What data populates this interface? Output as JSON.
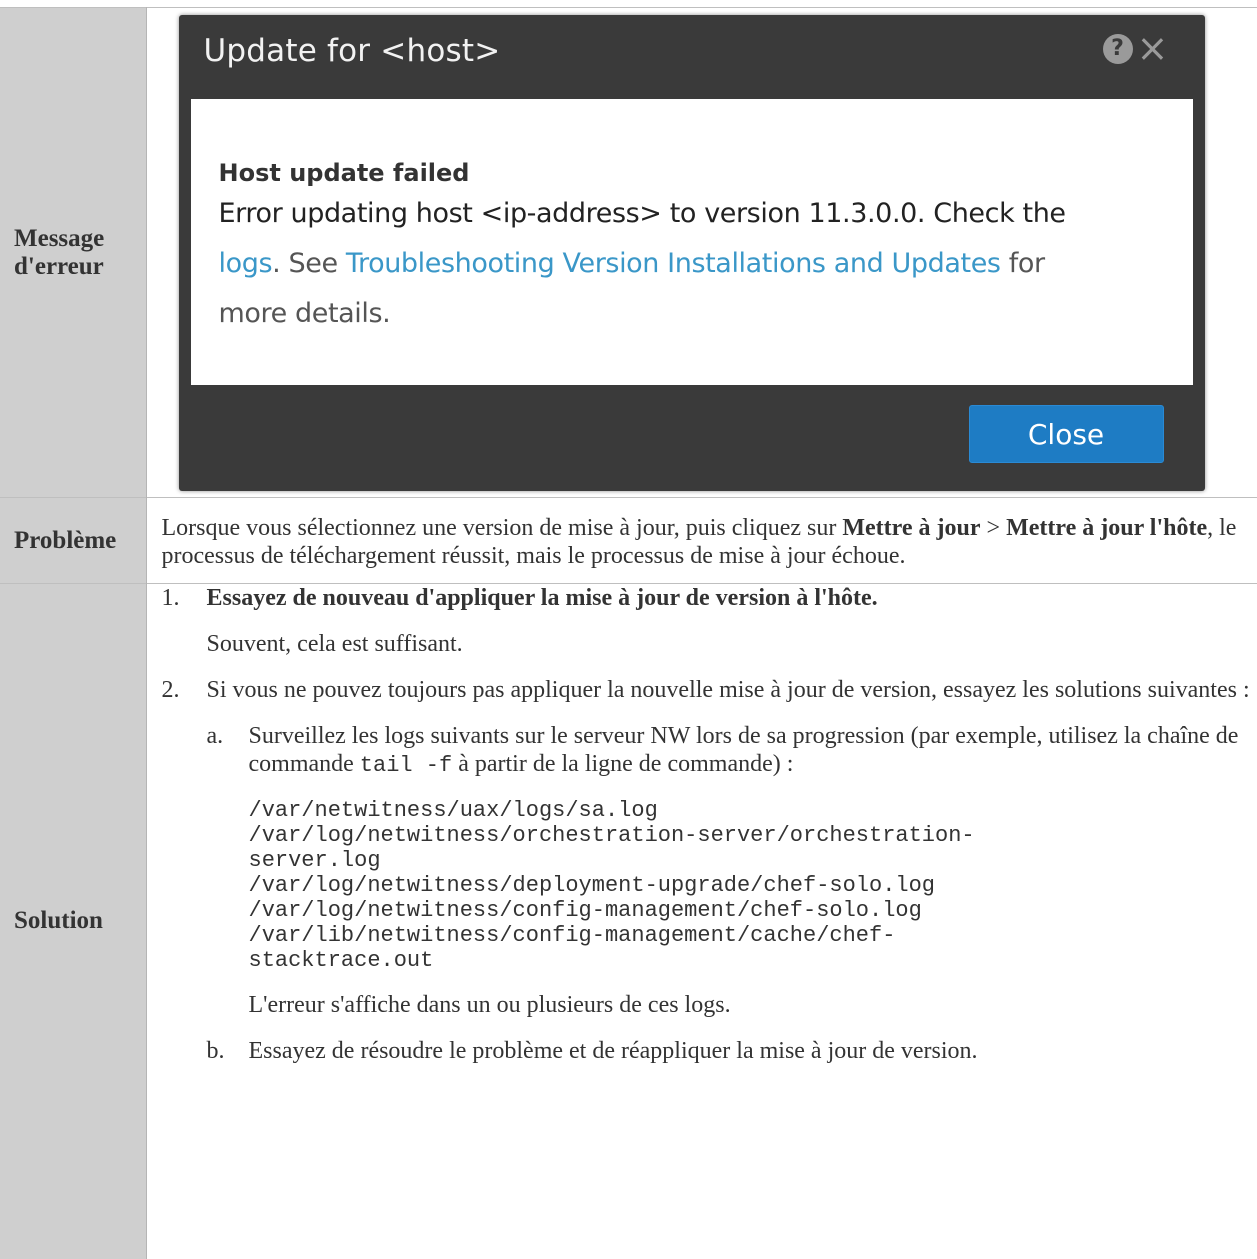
{
  "rows": {
    "message_label": "Message d'erreur",
    "problem_label": "Problème",
    "solution_label": "Solution"
  },
  "dialog": {
    "title": "Update for <host>",
    "help_icon": "?",
    "close_icon": "×",
    "heading": "Host update failed",
    "line1": "Error updating host <ip-address> to version 11.3.0.0. Check the",
    "link_logs": "logs",
    "after_logs": ". See ",
    "link_troubleshooting": "Troubleshooting Version Installations and Updates",
    "after_link": " for",
    "line3": "more details.",
    "close_button": "Close"
  },
  "problem": {
    "text1": "Lorsque vous sélectionnez une version de mise à jour, puis cliquez sur ",
    "bold1": "Mettre à jour",
    "text2": " > ",
    "bold2": "Mettre à jour l'hôte",
    "text3": ", le processus de téléchargement réussit, mais le processus de mise à jour échoue."
  },
  "solution": {
    "step1_num": "1.",
    "step1_bold": "Essayez de nouveau d'appliquer la mise à jour de version à l'hôte.",
    "step1_para": "Souvent, cela est suffisant.",
    "step2_num": "2.",
    "step2_text": "Si vous ne pouvez toujours pas appliquer la nouvelle mise à jour de version, essayez les solutions suivantes :",
    "sub_a_letter": "a.",
    "sub_a_text1": "Surveillez les logs suivants sur le serveur NW lors de sa progression (par exemple, utilisez la chaîne de commande ",
    "sub_a_code": "tail -f",
    "sub_a_text2": " à partir de la ligne de commande) :",
    "log_paths": "/var/netwitness/uax/logs/sa.log\n/var/log/netwitness/orchestration-server/orchestration-\nserver.log\n/var/log/netwitness/deployment-upgrade/chef-solo.log\n/var/log/netwitness/config-management/chef-solo.log\n/var/lib/netwitness/config-management/cache/chef-\nstacktrace.out",
    "sub_a_para": "L'erreur s'affiche dans un ou plusieurs de ces logs.",
    "sub_b_letter": "b.",
    "sub_b_text": "Essayez de résoudre le problème et de réappliquer la mise à jour de version."
  }
}
